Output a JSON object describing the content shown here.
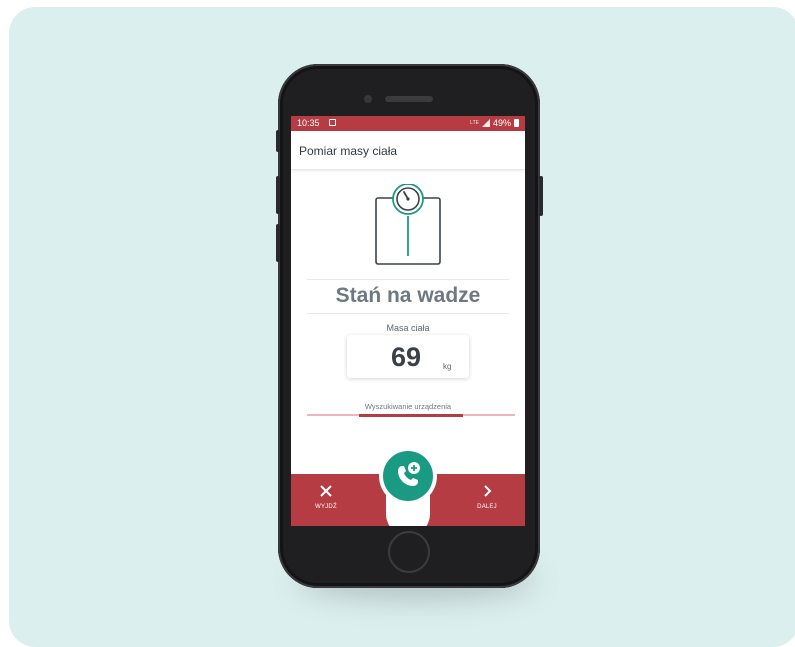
{
  "status": {
    "time": "10:35",
    "network": "LTE",
    "battery": "49%"
  },
  "appbar": {
    "title": "Pomiar masy ciała"
  },
  "main": {
    "instruction": "Stań na wadze",
    "mass_label": "Masa ciała",
    "mass_value": "69",
    "mass_unit": "kg",
    "search_status": "Wyszukiwanie urządzenia",
    "search_progress": 0.5
  },
  "bottom_nav": {
    "exit_label": "WYJDŹ",
    "next_label": "DALEJ"
  },
  "colors": {
    "accent_red": "#b53c43",
    "accent_green": "#1a9a82",
    "card_bg": "#dcefef",
    "phone_body": "#1f1f21"
  },
  "icons": {
    "exit": "close-icon",
    "next": "chevron-right-icon",
    "fab": "phone-plus-icon",
    "scale": "bathroom-scale-icon"
  }
}
